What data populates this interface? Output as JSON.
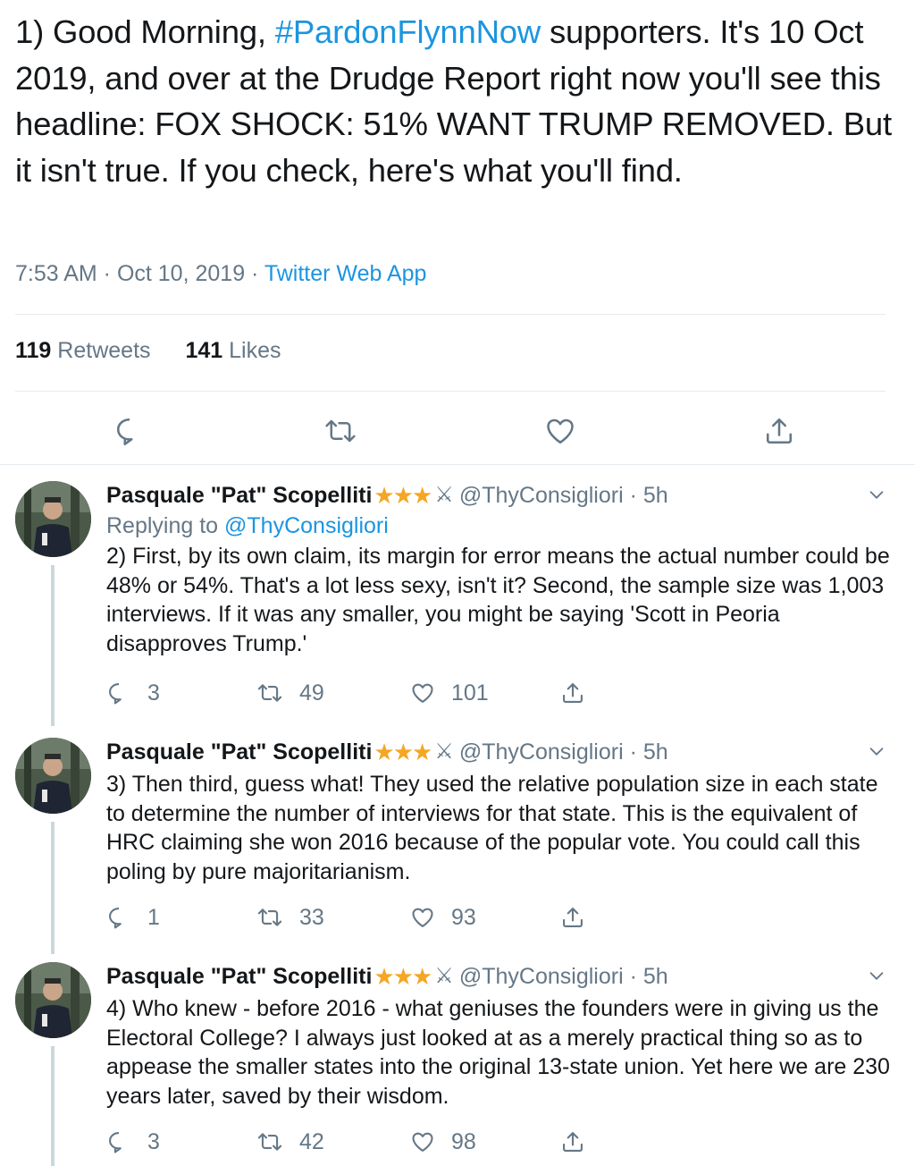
{
  "main_tweet": {
    "text_prefix": "1) Good Morning, ",
    "hashtag": "#PardonFlynnNow",
    "text_suffix": " supporters. It's 10 Oct 2019, and over at the Drudge Report right now you'll see this headline: FOX SHOCK: 51% WANT TRUMP REMOVED. But it isn't true. If you check, here's what you'll find.",
    "time": "7:53 AM · Oct 10, 2019 · ",
    "source": "Twitter Web App",
    "retweets_count": "119",
    "retweets_label": "Retweets",
    "likes_count": "141",
    "likes_label": "Likes"
  },
  "replies": [
    {
      "name": "Pasquale \"Pat\" Scopelliti",
      "stars": "★★★",
      "swords": "⚔",
      "handle": "@ThyConsigliori · 5h",
      "replying_label": "Replying to ",
      "replying_to": "@ThyConsigliori",
      "text": "2) First, by its own claim, its margin for error means the actual number could be 48% or 54%. That's a lot less sexy, isn't it? Second, the sample size was 1,003 interviews. If it was any smaller, you might be saying 'Scott in Peoria disapproves Trump.'",
      "reply_count": "3",
      "retweet_count": "49",
      "like_count": "101"
    },
    {
      "name": "Pasquale \"Pat\" Scopelliti",
      "stars": "★★★",
      "swords": "⚔",
      "handle": "@ThyConsigliori · 5h",
      "text": "3) Then third, guess what! They used the relative population size in each state to determine the number of interviews for that state. This is the equivalent of HRC claiming she won 2016 because of the popular vote. You could call this poling by pure majoritarianism.",
      "reply_count": "1",
      "retweet_count": "33",
      "like_count": "93"
    },
    {
      "name": "Pasquale \"Pat\" Scopelliti",
      "stars": "★★★",
      "swords": "⚔",
      "handle": "@ThyConsigliori · 5h",
      "text": "4) Who knew - before 2016 - what geniuses the founders were in giving us the Electoral College? I always just looked at as a merely practical thing so as to appease the smaller states into the original 13-state union. Yet here we are 230 years later, saved by their wisdom.",
      "reply_count": "3",
      "retweet_count": "42",
      "like_count": "98"
    }
  ],
  "icons": {
    "reply": "comment-bubble-icon",
    "retweet": "retweet-icon",
    "like": "heart-icon",
    "share": "share-icon",
    "more": "chevron-down-icon"
  },
  "colors": {
    "accent": "#1b95e0",
    "text": "#14171a",
    "muted": "#657786",
    "star": "#f5a623",
    "divider": "#e6ecf0"
  }
}
